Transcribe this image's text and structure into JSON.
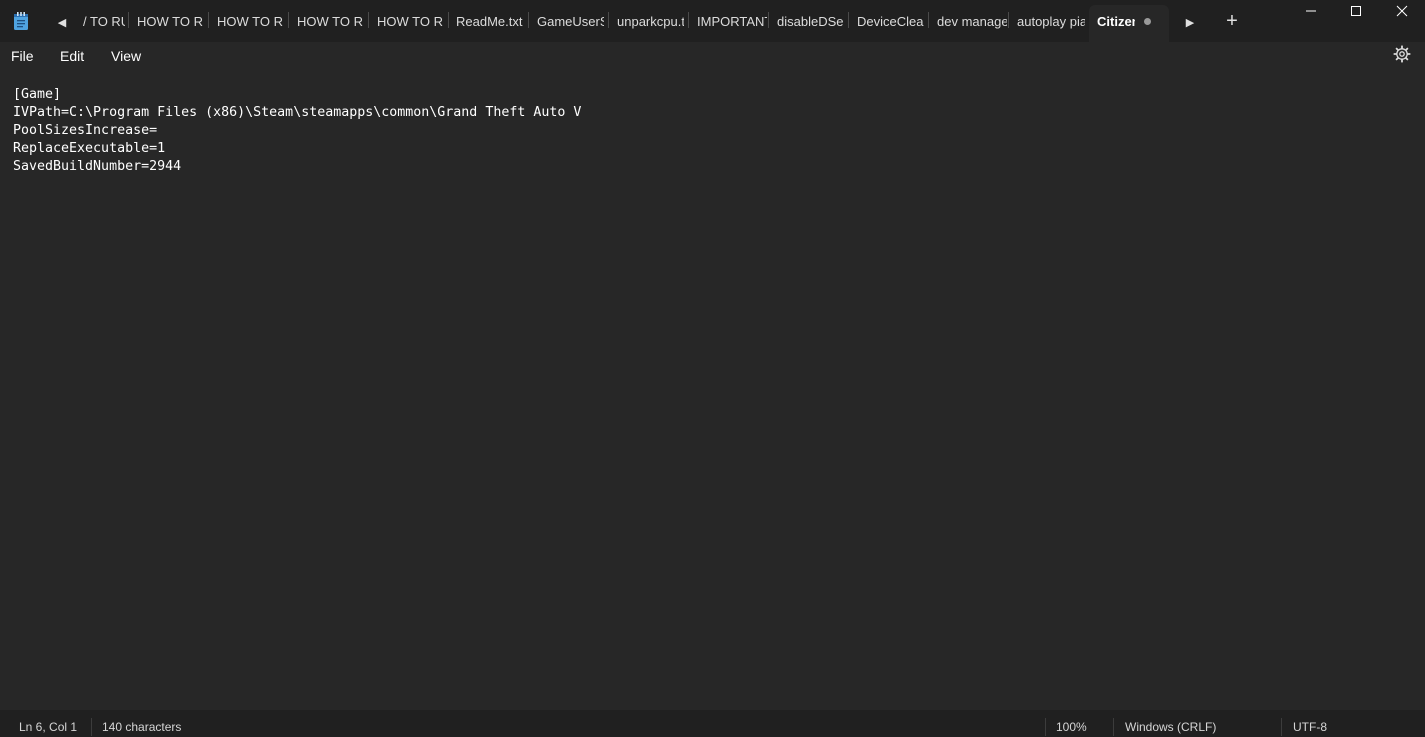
{
  "tabs": [
    {
      "label": "/ TO RUN"
    },
    {
      "label": "HOW TO RUN"
    },
    {
      "label": "HOW TO RUN"
    },
    {
      "label": "HOW TO RUN"
    },
    {
      "label": "HOW TO RUN"
    },
    {
      "label": "ReadMe.txt"
    },
    {
      "label": "GameUserSettings"
    },
    {
      "label": "unparkcpu.txt"
    },
    {
      "label": "IMPORTANT"
    },
    {
      "label": "disableDSearch"
    },
    {
      "label": "DeviceCleanup"
    },
    {
      "label": "dev manage"
    },
    {
      "label": "autoplay pia"
    }
  ],
  "active_tab": {
    "label": "Citizen"
  },
  "menu": {
    "file": "File",
    "edit": "Edit",
    "view": "View"
  },
  "editor": {
    "lines": [
      "[Game]",
      "IVPath=C:\\Program Files (x86)\\Steam\\steamapps\\common\\Grand Theft Auto V",
      "PoolSizesIncrease=",
      "ReplaceExecutable=1",
      "SavedBuildNumber=2944"
    ]
  },
  "status": {
    "position": "Ln 6, Col 1",
    "characters": "140 characters",
    "zoom": "100%",
    "line_ending": "Windows (CRLF)",
    "encoding": "UTF-8"
  },
  "icons": {
    "app": "notepad-icon",
    "scroll_left": "caret-left-icon",
    "scroll_right": "caret-right-icon",
    "add_tab": "plus-icon",
    "minimize": "minimize-icon",
    "maximize": "maximize-icon",
    "close": "close-icon",
    "settings": "gear-icon"
  },
  "colors": {
    "titlebar": "#202020",
    "editor_bg": "#272727",
    "text": "#ffffff",
    "app_icon": "#4fa3e0"
  }
}
